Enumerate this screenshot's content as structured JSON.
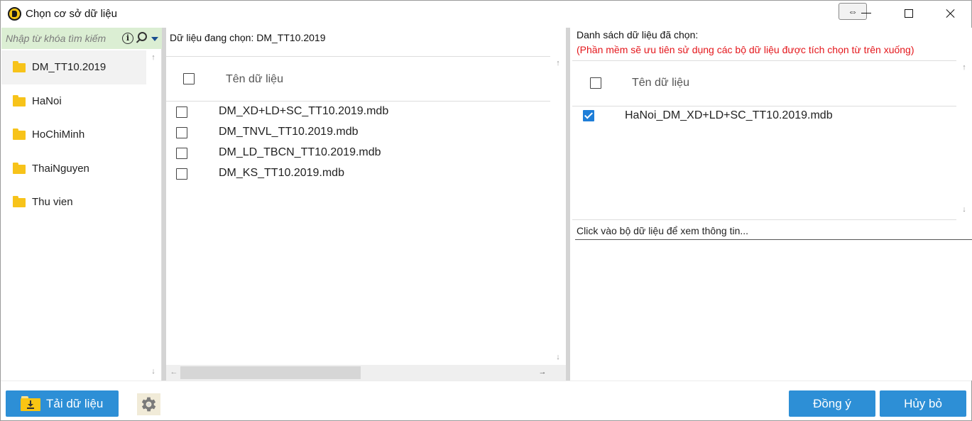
{
  "window": {
    "title": "Chọn cơ sở dữ liệu",
    "resize_glyph": "⇔"
  },
  "search": {
    "placeholder": "Nhập từ khóa tìm kiếm",
    "info_glyph": "i"
  },
  "folders": [
    {
      "label": "DM_TT10.2019",
      "selected": true
    },
    {
      "label": "HaNoi",
      "selected": false
    },
    {
      "label": "HoChiMinh",
      "selected": false
    },
    {
      "label": "ThaiNguyen",
      "selected": false
    },
    {
      "label": "Thu vien",
      "selected": false
    }
  ],
  "middle": {
    "header": "Dữ liệu đang chọn: DM_TT10.2019",
    "column_header": "Tên dữ liệu",
    "rows": [
      {
        "label": "DM_XD+LD+SC_TT10.2019.mdb",
        "checked": false
      },
      {
        "label": "DM_TNVL_TT10.2019.mdb",
        "checked": false
      },
      {
        "label": "DM_LD_TBCN_TT10.2019.mdb",
        "checked": false
      },
      {
        "label": "DM_KS_TT10.2019.mdb",
        "checked": false
      }
    ]
  },
  "right": {
    "header": "Danh sách dữ liệu đã chọn:",
    "note": "(Phần mềm sẽ ưu tiên sử dụng các bộ dữ liệu được tích chọn từ trên xuống)",
    "column_header": "Tên dữ liệu",
    "rows": [
      {
        "label": "HaNoi_DM_XD+LD+SC_TT10.2019.mdb",
        "checked": true
      }
    ],
    "info_text": "Click vào bộ dữ liệu để xem thông tin..."
  },
  "scroll_arrows": {
    "up": "↑",
    "down": "↓",
    "left": "←",
    "right": "→"
  },
  "buttons": {
    "load_label": "Tải dữ liệu",
    "ok_label": "Đồng ý",
    "cancel_label": "Hủy bỏ"
  },
  "icons": {
    "app": "app-logo-icon",
    "folder": "folder-icon",
    "search": "search-icon",
    "info": "info-icon",
    "download": "download-folder-icon",
    "settings": "gear-icon"
  },
  "colors": {
    "accent_button": "#2d8fd6",
    "search_bar_bg": "#dbeed3",
    "folder_yellow": "#f7c31a",
    "note_red": "#e4161b",
    "checkbox_checked": "#1e7ed8"
  }
}
